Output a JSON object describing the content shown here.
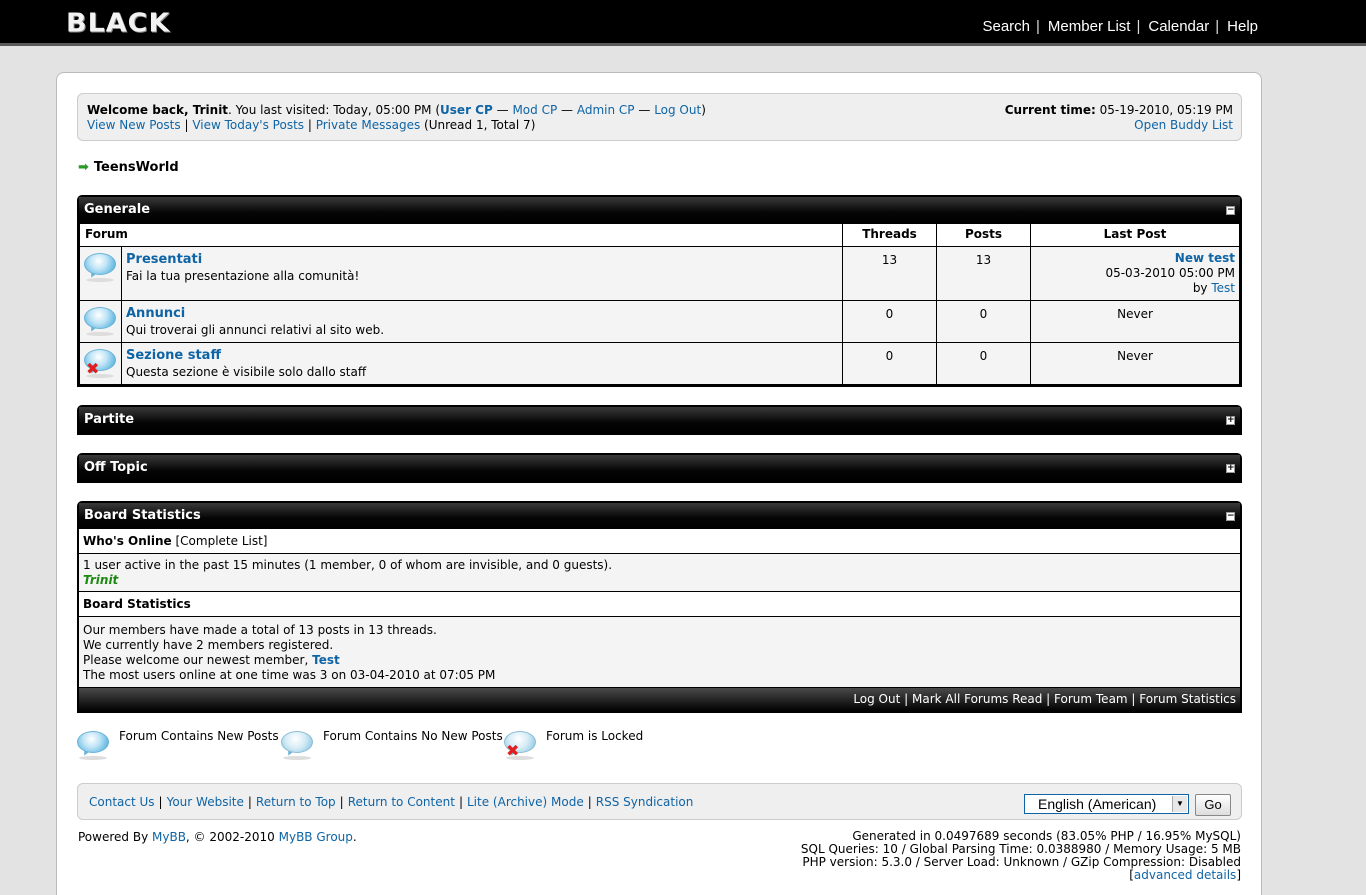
{
  "header": {
    "logo": "BLACK",
    "nav": [
      "Search",
      "Member List",
      "Calendar",
      "Help"
    ]
  },
  "welcome": {
    "greeting": "Welcome back, Trinit",
    "visited": ". You last visited: Today, 05:00 PM (",
    "links": [
      "User CP",
      "Mod CP",
      "Admin CP",
      "Log Out"
    ],
    "dash": "—",
    "close_paren": ")",
    "row2_links": [
      "View New Posts",
      "View Today's Posts",
      "Private Messages"
    ],
    "pm_counts": "(Unread 1, Total 7)",
    "current_time_label": "Current time:",
    "current_time": "05-19-2010, 05:19 PM",
    "buddy_list": "Open Buddy List"
  },
  "breadcrumb": "TeensWorld",
  "categories": {
    "generale": {
      "title": "Generale",
      "toggle": "−",
      "columns": [
        "Forum",
        "Threads",
        "Posts",
        "Last Post"
      ],
      "forums": [
        {
          "name": "Presentati",
          "desc": "Fai la tua presentazione alla comunità!",
          "threads": "13",
          "posts": "13",
          "last_title": "New test",
          "last_date": "05-03-2010 05:00 PM",
          "last_by": "by",
          "last_user": "Test"
        },
        {
          "name": "Annunci",
          "desc": "Qui troverai gli annunci relativi al sito web.",
          "threads": "0",
          "posts": "0",
          "last": "Never"
        },
        {
          "name": "Sezione staff",
          "desc": "Questa sezione è visibile solo dallo staff",
          "threads": "0",
          "posts": "0",
          "last": "Never"
        }
      ]
    },
    "partite": {
      "title": "Partite",
      "toggle": "+"
    },
    "offtopic": {
      "title": "Off Topic",
      "toggle": "+"
    }
  },
  "stats": {
    "title": "Board Statistics",
    "toggle": "−",
    "whos_online": "Who's Online",
    "complete_list": "[Complete List]",
    "online_text": "1 user active in the past 15 minutes (1 member, 0 of whom are invisible, and 0 guests).",
    "online_user": "Trinit",
    "board_stats_label": "Board Statistics",
    "line1": "Our members have made a total of 13 posts in 13 threads.",
    "line2": "We currently have 2 members registered.",
    "line3_prefix": "Please welcome our newest member,",
    "newest_member": "Test",
    "line4": "The most users online at one time was 3 on 03-04-2010 at 07:05 PM",
    "footer_links": [
      "Log Out",
      "Mark All Forums Read",
      "Forum Team",
      "Forum Statistics"
    ]
  },
  "legend": [
    "Forum Contains New Posts",
    "Forum Contains No New Posts",
    "Forum is Locked"
  ],
  "bottom": {
    "links": [
      "Contact Us",
      "Your Website",
      "Return to Top",
      "Return to Content",
      "Lite (Archive) Mode",
      "RSS Syndication"
    ],
    "language": "English (American)",
    "go": "Go"
  },
  "powered": {
    "prefix": "Powered By",
    "mybb": "MyBB",
    "middle": ", © 2002-2010",
    "group": "MyBB Group",
    "suffix": "."
  },
  "debug": {
    "line1": "Generated in 0.0497689 seconds (83.05% PHP / 16.95% MySQL)",
    "line2": "SQL Queries: 10 / Global Parsing Time: 0.0388980 / Memory Usage: 5 MB",
    "line3": "PHP version: 5.3.0 / Server Load: Unknown / GZip Compression: Disabled",
    "advanced": "advanced details"
  }
}
